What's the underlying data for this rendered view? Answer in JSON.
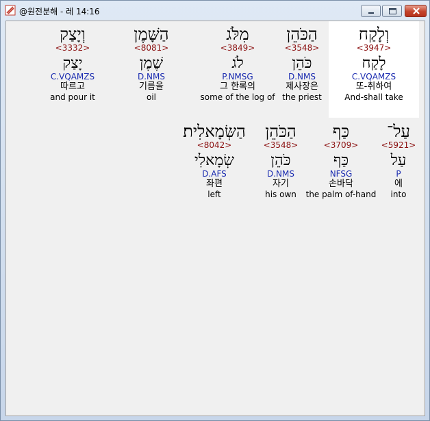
{
  "window": {
    "title": "@원전분해 - 레 14:16",
    "icon": "hebrew-analysis-app-icon"
  },
  "controls": {
    "minimize": "minimize-icon",
    "maximize": "maximize-icon",
    "close": "close-icon"
  },
  "colors": {
    "strong": "#8b1010",
    "parse": "#1a2bb0",
    "highlight": "#ffffff"
  },
  "rows": [
    {
      "words": [
        {
          "hebrew": "וְלָקַח",
          "strong": "<3947>",
          "lemma": "לָקַח",
          "parse": "C.VQAMZS",
          "korean": "또-취하여",
          "english": "And-shall take",
          "selected": true
        },
        {
          "hebrew": "הַכֹּהֵן",
          "strong": "<3548>",
          "lemma": "כֹּהֵן",
          "parse": "D.NMS",
          "korean": "제사장은",
          "english": "the priest"
        },
        {
          "hebrew": "מִלֹּג",
          "strong": "<3849>",
          "lemma": "לֹג",
          "parse": "P.NMSG",
          "korean": "그 한록의",
          "english": "some of the log of"
        },
        {
          "hebrew": "הַשָּׁמֶן",
          "strong": "<8081>",
          "lemma": "שֶׁמֶן",
          "parse": "D.NMS",
          "korean": "기름을",
          "english": "oil"
        },
        {
          "hebrew": "וְיָצַק",
          "strong": "<3332>",
          "lemma": "יָצַק",
          "parse": "C.VQAMZS",
          "korean": "따르고",
          "english": "and pour it"
        }
      ]
    },
    {
      "words": [
        {
          "hebrew": "עַל־",
          "strong": "<5921>",
          "lemma": "עַל",
          "parse": "P",
          "korean": "에",
          "english": "into"
        },
        {
          "hebrew": "כַּף",
          "strong": "<3709>",
          "lemma": "כַּף",
          "parse": "NFSG",
          "korean": "손바닥",
          "english": "the palm of-hand"
        },
        {
          "hebrew": "הַכֹּהֵן",
          "strong": "<3548>",
          "lemma": "כֹּהֵן",
          "parse": "D.NMS",
          "korean": "자기",
          "english": "his own"
        },
        {
          "hebrew": "הַשְּׂמָאלִית׃",
          "strong": "<8042>",
          "lemma": "שְׂמָאלִי",
          "parse": "D.AFS",
          "korean": "좌편",
          "english": "left"
        }
      ]
    }
  ]
}
